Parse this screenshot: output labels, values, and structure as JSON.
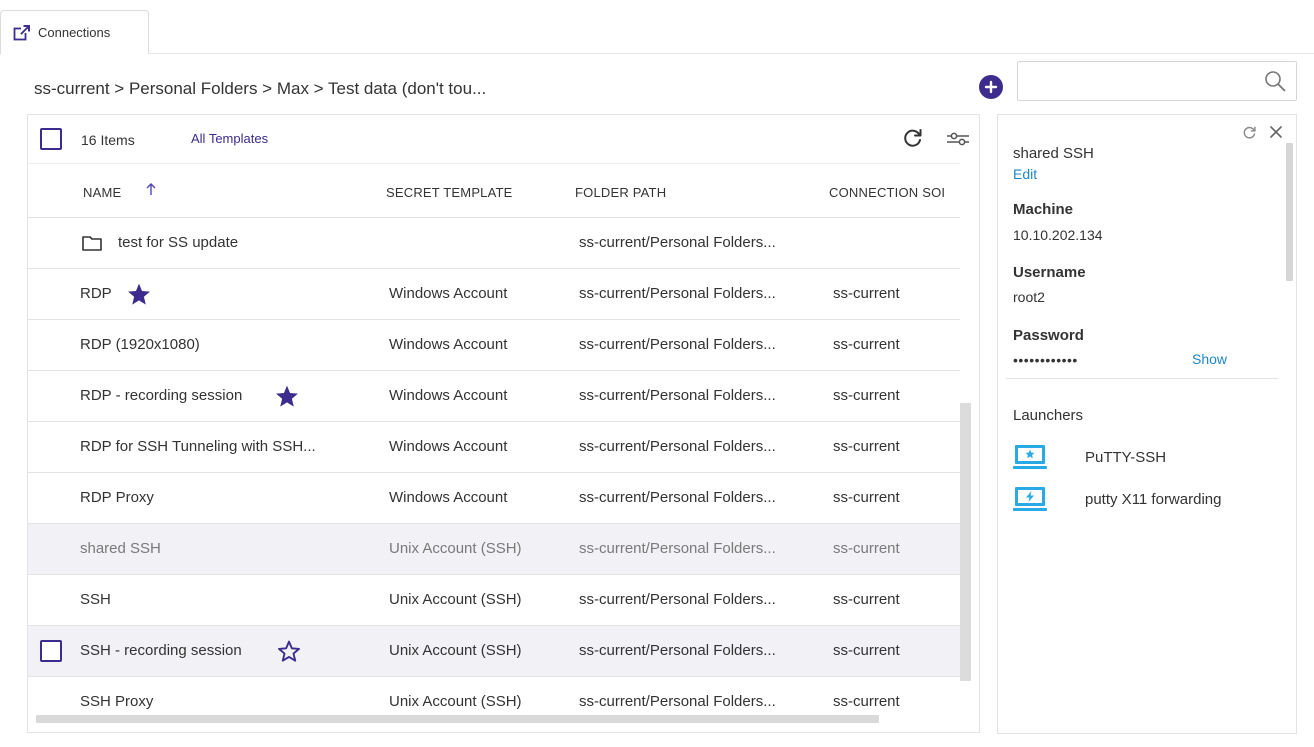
{
  "tab": {
    "label": "Connections"
  },
  "breadcrumb": "ss-current > Personal Folders > Max > Test data (don't tou...",
  "search": {
    "placeholder": "",
    "value": ""
  },
  "toolbar": {
    "items_count": "16 Items",
    "templates_link": "All Templates"
  },
  "columns": {
    "name": "NAME",
    "secret_template": "SECRET TEMPLATE",
    "folder_path": "FOLDER PATH",
    "connection_source": "CONNECTION SOI"
  },
  "rows": [
    {
      "name": "test for SS update",
      "template": "",
      "folder": "ss-current/Personal Folders...",
      "source": ""
    },
    {
      "name": "RDP",
      "template": "Windows Account",
      "folder": "ss-current/Personal Folders...",
      "source": "ss-current"
    },
    {
      "name": "RDP (1920x1080)",
      "template": "Windows Account",
      "folder": "ss-current/Personal Folders...",
      "source": "ss-current"
    },
    {
      "name": "RDP - recording session",
      "template": "Windows Account",
      "folder": "ss-current/Personal Folders...",
      "source": "ss-current"
    },
    {
      "name": "RDP for SSH Tunneling with SSH...",
      "template": "Windows Account",
      "folder": "ss-current/Personal Folders...",
      "source": "ss-current"
    },
    {
      "name": "RDP Proxy",
      "template": "Windows Account",
      "folder": "ss-current/Personal Folders...",
      "source": "ss-current"
    },
    {
      "name": "shared SSH",
      "template": "Unix Account (SSH)",
      "folder": "ss-current/Personal Folders...",
      "source": "ss-current"
    },
    {
      "name": "SSH",
      "template": "Unix Account (SSH)",
      "folder": "ss-current/Personal Folders...",
      "source": "ss-current"
    },
    {
      "name": "SSH - recording session",
      "template": "Unix Account (SSH)",
      "folder": "ss-current/Personal Folders...",
      "source": "ss-current"
    },
    {
      "name": "SSH Proxy",
      "template": "Unix Account (SSH)",
      "folder": "ss-current/Personal Folders...",
      "source": "ss-current"
    }
  ],
  "detail": {
    "title": "shared SSH",
    "edit": "Edit",
    "machine_label": "Machine",
    "machine_value": "10.10.202.134",
    "username_label": "Username",
    "username_value": "root2",
    "password_label": "Password",
    "password_value": "••••••••••••",
    "show_link": "Show",
    "launchers_label": "Launchers",
    "launchers": [
      {
        "name": "PuTTY-SSH"
      },
      {
        "name": "putty X11 forwarding"
      }
    ]
  },
  "colors": {
    "accent": "#3d2b8e",
    "link": "#1e88c7",
    "launcher": "#29a9e6"
  }
}
